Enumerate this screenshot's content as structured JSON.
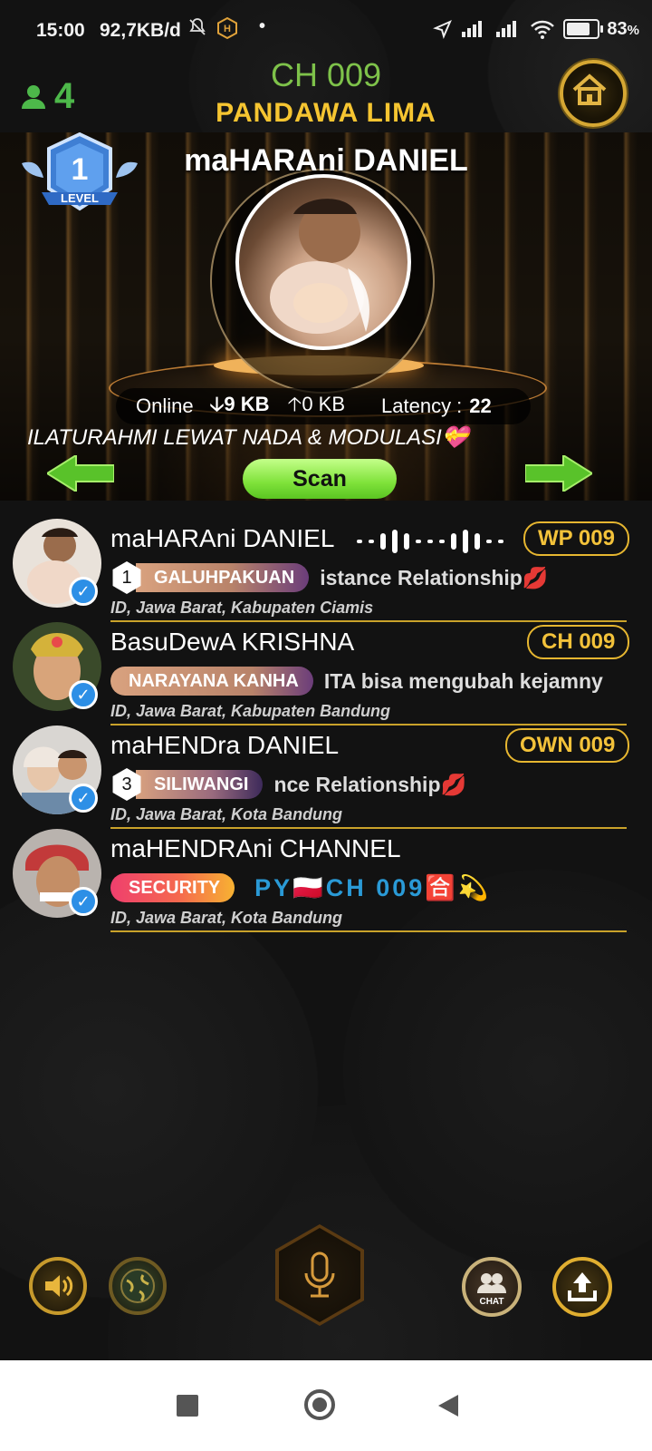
{
  "status_bar": {
    "time": "15:00",
    "net_speed": "92,7KB/d",
    "battery": "83",
    "battery_unit": "%",
    "battery_level": 0.83
  },
  "header": {
    "user_count": "4",
    "channel": "CH 009",
    "room_name": "PANDAWA LIMA"
  },
  "stage": {
    "host_name": "maHARAni DANIEL",
    "level_number": "1",
    "level_label": "LEVEL",
    "online_label": "Online",
    "download": "9 KB",
    "upload": "0 KB",
    "latency_label": "Latency :",
    "latency_value": "22",
    "marquee": "ILATURAHMI LEWAT NADA & MODULASI💝",
    "scan_label": "Scan"
  },
  "members": [
    {
      "name": "maHARAni DANIEL",
      "tag": "WP 009",
      "rank": "1",
      "group": "GALUHPAKUAN",
      "bio": "istance Relationship💋",
      "location": "ID, Jawa Barat, Kabupaten Ciamis",
      "speaking": true,
      "group_color": "#b8836a"
    },
    {
      "name": "BasuDewA KRISHNA",
      "tag": "CH 009",
      "rank": "",
      "group": "NARAYANA KANHA",
      "bio": "ITA bisa mengubah kejamny",
      "location": "ID, Jawa Barat, Kabupaten Bandung",
      "speaking": false,
      "group_color": "#b8836a"
    },
    {
      "name": "maHENDra DANIEL",
      "tag": "OWN 009",
      "rank": "3",
      "group": "SILIWANGI",
      "bio": "nce Relationship💋",
      "location": "ID, Jawa Barat, Kota Bandung",
      "speaking": false,
      "group_color": "#7f5b8a"
    },
    {
      "name": "maHENDRAni CHANNEL",
      "tag": "",
      "rank": "",
      "group": "SECURITY",
      "bio": "PY🇵🇱CH 009🈴💫",
      "location": "ID, Jawa Barat, Kota Bandung",
      "speaking": false,
      "group_color": "#ef3f6e"
    }
  ],
  "bottom_bar": {
    "chat_label": "CHAT"
  },
  "colors": {
    "accent_gold": "#f6c531",
    "channel_green": "#7ec24a",
    "verified_blue": "#2d8fe6"
  }
}
